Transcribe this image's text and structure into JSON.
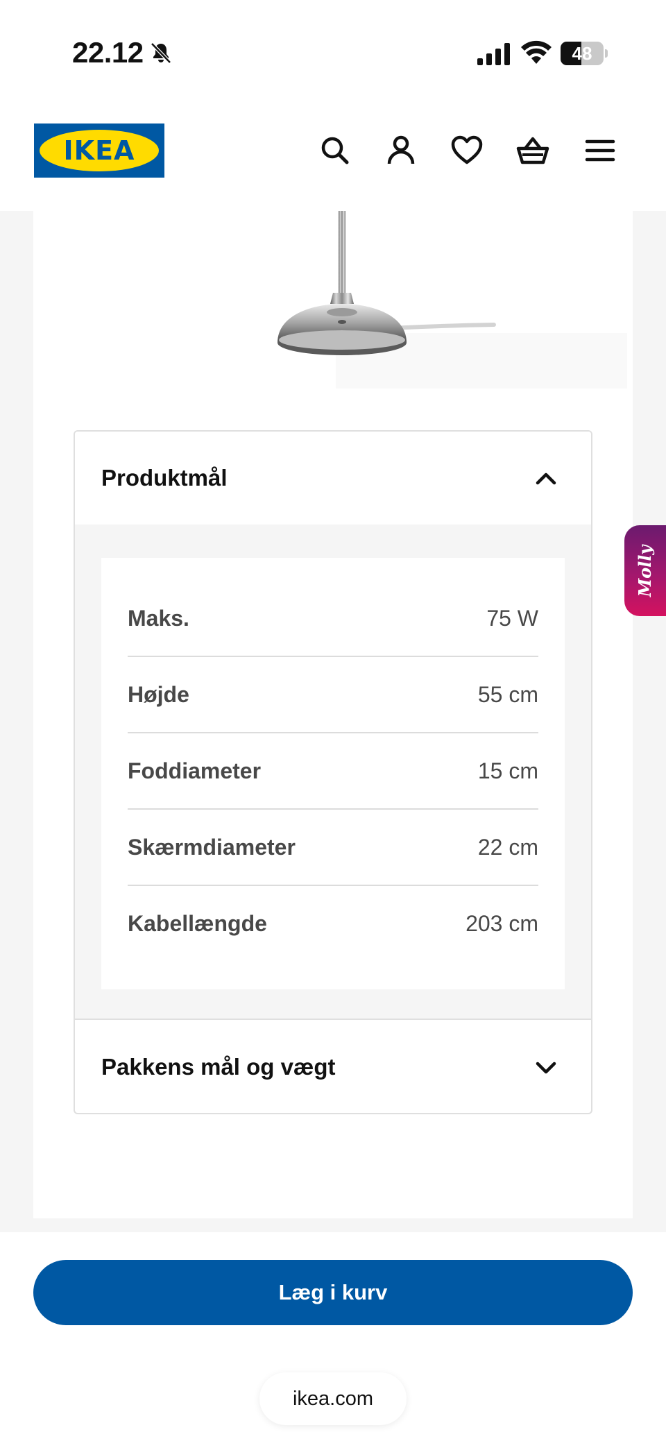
{
  "status_bar": {
    "time": "22.12",
    "battery_level": "48",
    "battery_fraction": 0.48
  },
  "header": {
    "logo_text": "IKEA",
    "icons": [
      "search-icon",
      "account-icon",
      "favorites-heart-icon",
      "cart-basket-icon",
      "menu-icon"
    ]
  },
  "product_dimensions": {
    "title": "Produktmål",
    "expanded": true,
    "rows": [
      {
        "label": "Maks.",
        "value": "75 W"
      },
      {
        "label": "Højde",
        "value": "55 cm"
      },
      {
        "label": "Foddiameter",
        "value": "15 cm"
      },
      {
        "label": "Skærmdiameter",
        "value": "22 cm"
      },
      {
        "label": "Kabellængde",
        "value": "203 cm"
      }
    ]
  },
  "package_section": {
    "title": "Pakkens mål og vægt",
    "expanded": false
  },
  "actions": {
    "add_to_cart_label": "Læg i kurv"
  },
  "browser": {
    "url": "ikea.com"
  },
  "chat_tab": {
    "label": "Molly"
  },
  "colors": {
    "ikea_blue": "#0058a3",
    "ikea_yellow": "#ffdb00",
    "molly_gradient_start": "#6b1a6e",
    "molly_gradient_end": "#d4125f"
  }
}
